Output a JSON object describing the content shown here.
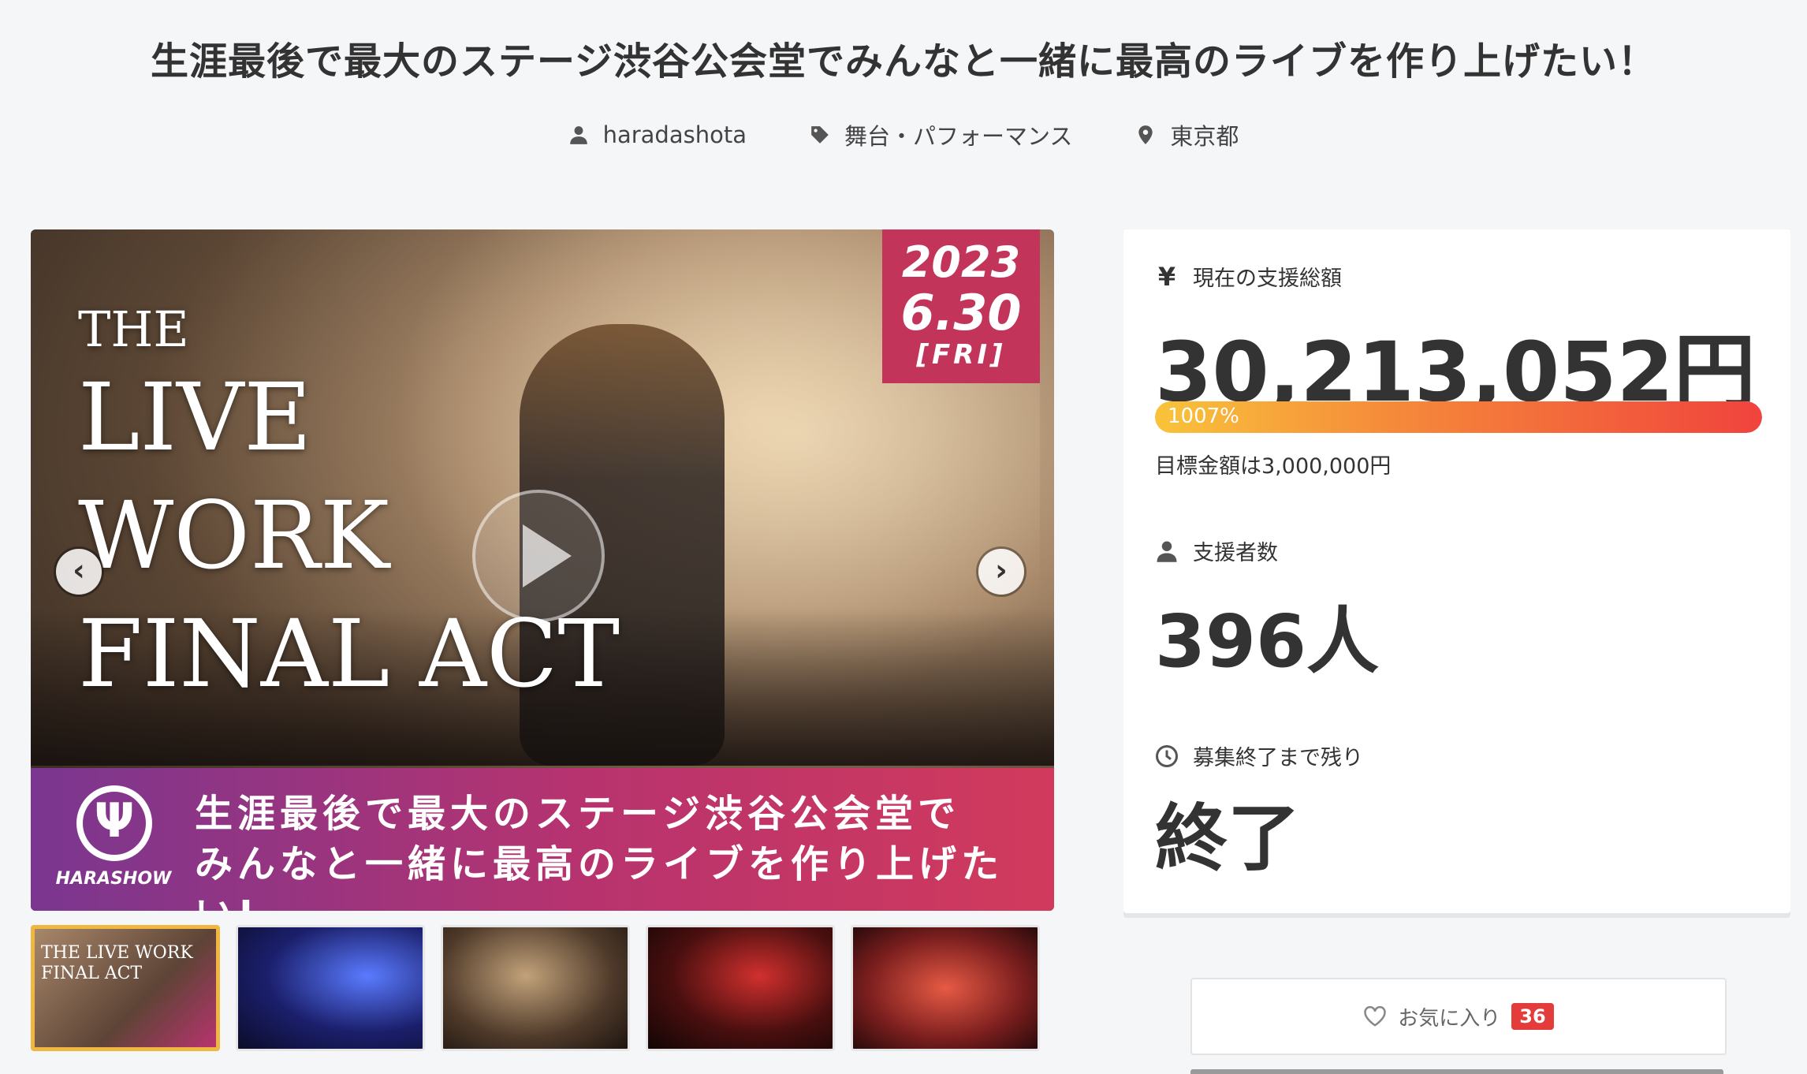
{
  "project": {
    "title": "生涯最後で最大のステージ渋谷公会堂でみんなと一緒に最高のライブを作り上げたい！",
    "owner": "haradashota",
    "category": "舞台・パフォーマンス",
    "location": "東京都"
  },
  "hero": {
    "headline_line1": "THE",
    "headline_line2": "LIVE",
    "headline_line3": "WORK",
    "headline_line4": "FINAL ACT",
    "date_year": "2023",
    "date_day": "6.30",
    "date_weekday": "[FRI]",
    "logo_name": "HARASHOW",
    "banner_line1": "生涯最後で最大のステージ渋谷公会堂で",
    "banner_line2": "みんなと一緒に最高のライブを作り上げたい!"
  },
  "thumbnails": {
    "first_caption": "THE LIVE WORK FINAL ACT"
  },
  "stats": {
    "total_label": "現在の支援総額",
    "total_icon": "yen-icon",
    "total_amount": "30,213,052円",
    "progress_percent": 1007,
    "progress_label": "1007%",
    "goal_text": "目標金額は3,000,000円",
    "backers_label": "支援者数",
    "backers_value": "396人",
    "remaining_label": "募集終了まで残り",
    "remaining_value": "終了"
  },
  "actions": {
    "favorite_label": "お気に入り",
    "favorite_count": "36"
  },
  "colors": {
    "accent": "#e43b3b",
    "progress_start": "#f9c33a",
    "progress_end": "#f0433d",
    "banner": "#b8336e"
  }
}
